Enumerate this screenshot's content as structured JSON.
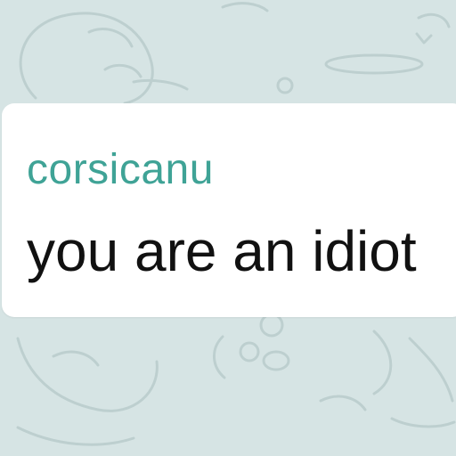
{
  "message": {
    "sender_name": "corsicanu",
    "text": "you are an idiot"
  },
  "colors": {
    "background": "#d6e4e4",
    "bubble": "#ffffff",
    "sender_name": "#3fa396",
    "message_text": "#111111",
    "doodle_stroke": "#b9cccc"
  }
}
